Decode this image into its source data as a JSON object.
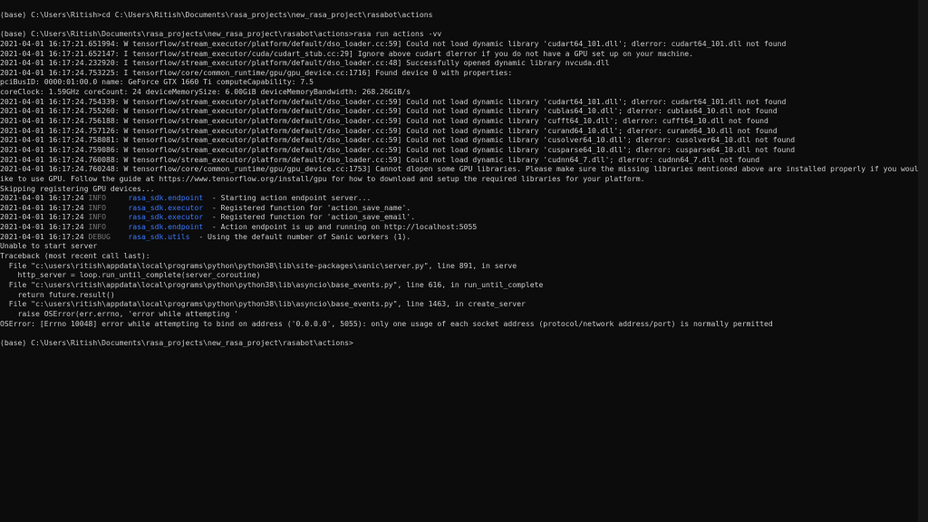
{
  "terminal": {
    "background_color": "#0c0c0c",
    "text_color": "#cccccc",
    "logger_color": "#3b78ff",
    "level_color": "#767676",
    "lines": [
      {
        "text": "(base) C:\\Users\\Ritish>cd C:\\Users\\Ritish\\Documents\\rasa_projects\\new_rasa_project\\rasabot\\actions"
      },
      {
        "text": ""
      },
      {
        "text": "(base) C:\\Users\\Ritish\\Documents\\rasa_projects\\new_rasa_project\\rasabot\\actions>rasa run actions -vv"
      },
      {
        "text": "2021-04-01 16:17:21.651994: W tensorflow/stream_executor/platform/default/dso_loader.cc:59] Could not load dynamic library 'cudart64_101.dll'; dlerror: cudart64_101.dll not found"
      },
      {
        "text": "2021-04-01 16:17:21.652147: I tensorflow/stream_executor/cuda/cudart_stub.cc:29] Ignore above cudart dlerror if you do not have a GPU set up on your machine."
      },
      {
        "text": "2021-04-01 16:17:24.232920: I tensorflow/stream_executor/platform/default/dso_loader.cc:48] Successfully opened dynamic library nvcuda.dll"
      },
      {
        "text": "2021-04-01 16:17:24.753225: I tensorflow/core/common_runtime/gpu/gpu_device.cc:1716] Found device 0 with properties:"
      },
      {
        "text": "pciBusID: 0000:01:00.0 name: GeForce GTX 1660 Ti computeCapability: 7.5"
      },
      {
        "text": "coreClock: 1.59GHz coreCount: 24 deviceMemorySize: 6.00GiB deviceMemoryBandwidth: 268.26GiB/s"
      },
      {
        "text": "2021-04-01 16:17:24.754339: W tensorflow/stream_executor/platform/default/dso_loader.cc:59] Could not load dynamic library 'cudart64_101.dll'; dlerror: cudart64_101.dll not found"
      },
      {
        "text": "2021-04-01 16:17:24.755260: W tensorflow/stream_executor/platform/default/dso_loader.cc:59] Could not load dynamic library 'cublas64_10.dll'; dlerror: cublas64_10.dll not found"
      },
      {
        "text": "2021-04-01 16:17:24.756188: W tensorflow/stream_executor/platform/default/dso_loader.cc:59] Could not load dynamic library 'cufft64_10.dll'; dlerror: cufft64_10.dll not found"
      },
      {
        "text": "2021-04-01 16:17:24.757126: W tensorflow/stream_executor/platform/default/dso_loader.cc:59] Could not load dynamic library 'curand64_10.dll'; dlerror: curand64_10.dll not found"
      },
      {
        "text": "2021-04-01 16:17:24.758081: W tensorflow/stream_executor/platform/default/dso_loader.cc:59] Could not load dynamic library 'cusolver64_10.dll'; dlerror: cusolver64_10.dll not found"
      },
      {
        "text": "2021-04-01 16:17:24.759086: W tensorflow/stream_executor/platform/default/dso_loader.cc:59] Could not load dynamic library 'cusparse64_10.dll'; dlerror: cusparse64_10.dll not found"
      },
      {
        "text": "2021-04-01 16:17:24.760088: W tensorflow/stream_executor/platform/default/dso_loader.cc:59] Could not load dynamic library 'cudnn64_7.dll'; dlerror: cudnn64_7.dll not found"
      },
      {
        "text": "2021-04-01 16:17:24.760248: W tensorflow/core/common_runtime/gpu/gpu_device.cc:1753] Cannot dlopen some GPU libraries. Please make sure the missing libraries mentioned above are installed properly if you would l"
      },
      {
        "text": "ike to use GPU. Follow the guide at https://www.tensorflow.org/install/gpu for how to download and setup the required libraries for your platform."
      },
      {
        "text": "Skipping registering GPU devices..."
      },
      {
        "prefix": "2021-04-01 16:17:24 ",
        "level": "INFO     ",
        "logger": "rasa_sdk.endpoint",
        "gap": "  ",
        "message": "- Starting action endpoint server..."
      },
      {
        "prefix": "2021-04-01 16:17:24 ",
        "level": "INFO     ",
        "logger": "rasa_sdk.executor",
        "gap": "  ",
        "message": "- Registered function for 'action_save_name'."
      },
      {
        "prefix": "2021-04-01 16:17:24 ",
        "level": "INFO     ",
        "logger": "rasa_sdk.executor",
        "gap": "  ",
        "message": "- Registered function for 'action_save_email'."
      },
      {
        "prefix": "2021-04-01 16:17:24 ",
        "level": "INFO     ",
        "logger": "rasa_sdk.endpoint",
        "gap": "  ",
        "message": "- Action endpoint is up and running on http://localhost:5055"
      },
      {
        "prefix": "2021-04-01 16:17:24 ",
        "level": "DEBUG    ",
        "logger": "rasa_sdk.utils",
        "gap": "  ",
        "message": "- Using the default number of Sanic workers (1)."
      },
      {
        "text": "Unable to start server"
      },
      {
        "text": "Traceback (most recent call last):"
      },
      {
        "text": "  File \"c:\\users\\ritish\\appdata\\local\\programs\\python\\python38\\lib\\site-packages\\sanic\\server.py\", line 891, in serve"
      },
      {
        "text": "    http_server = loop.run_until_complete(server_coroutine)"
      },
      {
        "text": "  File \"c:\\users\\ritish\\appdata\\local\\programs\\python\\python38\\lib\\asyncio\\base_events.py\", line 616, in run_until_complete"
      },
      {
        "text": "    return future.result()"
      },
      {
        "text": "  File \"c:\\users\\ritish\\appdata\\local\\programs\\python\\python38\\lib\\asyncio\\base_events.py\", line 1463, in create_server"
      },
      {
        "text": "    raise OSError(err.errno, 'error while attempting '"
      },
      {
        "text": "OSError: [Errno 10048] error while attempting to bind on address ('0.0.0.0', 5055): only one usage of each socket address (protocol/network address/port) is normally permitted"
      },
      {
        "text": ""
      },
      {
        "text": "(base) C:\\Users\\Ritish\\Documents\\rasa_projects\\new_rasa_project\\rasabot\\actions>"
      }
    ]
  }
}
